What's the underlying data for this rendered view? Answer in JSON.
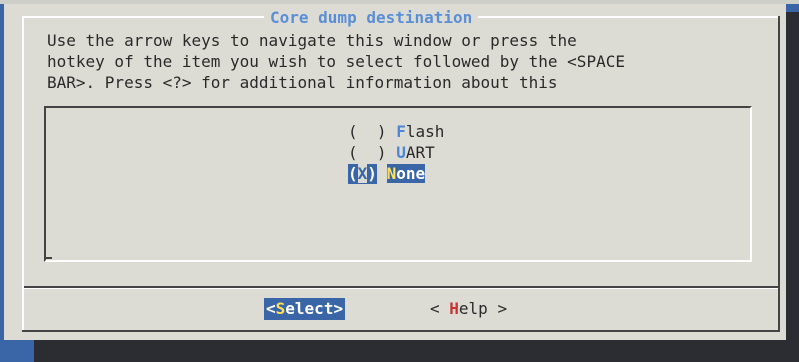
{
  "dialog": {
    "title": "Core dump destination",
    "description": [
      "Use the arrow keys to navigate this window or press the",
      "hotkey of the item you wish to select followed by the <SPACE",
      "BAR>. Press <?> for additional information about this"
    ]
  },
  "options": [
    {
      "radio_left": "( ",
      "radio_mark": " ",
      "radio_right": ")",
      "hotkey": "F",
      "rest": "lash",
      "selected": false
    },
    {
      "radio_left": "( ",
      "radio_mark": " ",
      "radio_right": ")",
      "hotkey": "U",
      "rest": "ART",
      "selected": false
    },
    {
      "radio_left": "(",
      "radio_mark": "X",
      "radio_right": ")",
      "hotkey": "N",
      "rest": "one",
      "selected": true
    }
  ],
  "buttons": {
    "select": {
      "left": "<",
      "hotkey": "S",
      "rest": "elect>"
    },
    "help": {
      "left": "< ",
      "hotkey": "H",
      "rest": "elp >"
    }
  },
  "colors": {
    "dialog_bg": "#dcdcd4",
    "accent_blue": "#3a66a8",
    "hotkey_blue": "#4d86d6",
    "hotkey_yellow": "#ffe25a",
    "help_hotkey_red": "#c83232"
  }
}
